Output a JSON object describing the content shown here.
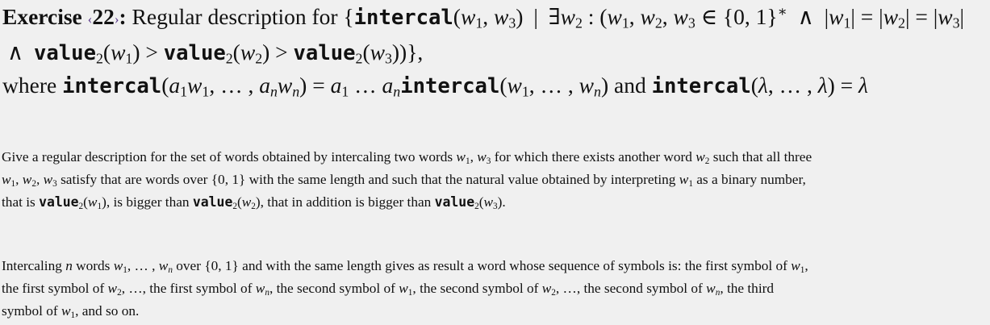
{
  "exercise": {
    "label": "Exercise",
    "number": "22",
    "title": "Regular description for"
  },
  "symbols": {
    "intercal": "intercal",
    "value": "value",
    "where": "where",
    "and": "and",
    "lambda": "λ",
    "set_01": "{0, 1}",
    "set_01_star": "{0, 1}*"
  },
  "paragraph1": {
    "t1": "Give a regular description for the set of words obtained by intercaling two words",
    "t2": "for which there exists another word",
    "t3": "such that all three",
    "t4": "satisfy that are words over",
    "t5": "with the same length and such that the natural value obtained by interpreting",
    "t6": "as a binary number, that is",
    "t7": ", is bigger than",
    "t8": ", that in addition is bigger than",
    "t9": "."
  },
  "paragraph2": {
    "t1": "Intercaling",
    "t2": "words",
    "t3": "over",
    "t4": "and with the same length gives as result a word whose sequence of symbols is: the first symbol of",
    "t5": ", the first symbol of",
    "t6": ", …, the first symbol of",
    "t7": ", the second symbol of",
    "t8": ", the second symbol of",
    "t9": ", …, the second symbol of",
    "t10": ", the third symbol of",
    "t11": ", and so on."
  }
}
